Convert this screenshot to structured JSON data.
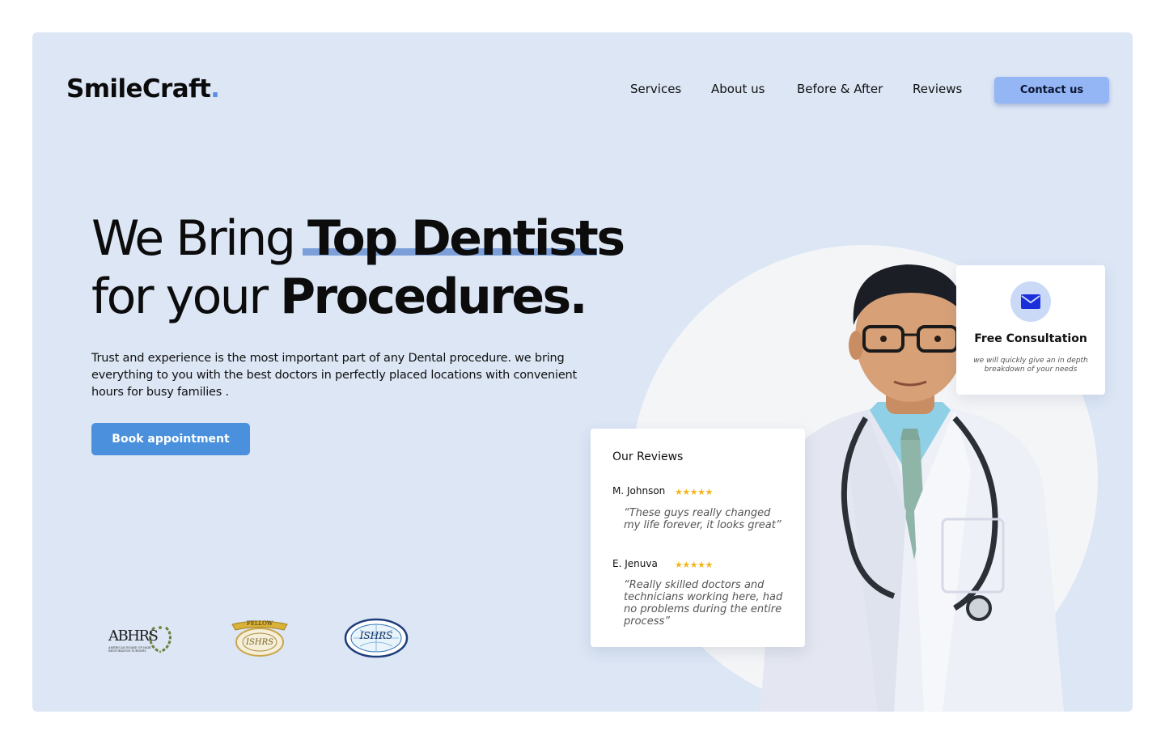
{
  "brand": {
    "name": "SmileCraft",
    "dot": "."
  },
  "nav": {
    "items": [
      {
        "label": "Services"
      },
      {
        "label": "About us"
      },
      {
        "label": "Before & After"
      },
      {
        "label": "Reviews"
      }
    ],
    "contact_label": "Contact  us"
  },
  "hero": {
    "line1_regular": "We Bring ",
    "line1_bold": "Top Dentists",
    "line2_regular": "for your ",
    "line2_bold": "Procedures.",
    "description": "Trust and experience is the most important part of any Dental procedure. we bring everything to you with the best doctors in perfectly placed locations with convenient hours for busy families .",
    "cta_label": "Book appointment"
  },
  "badges": {
    "abhrs": {
      "acronym": "ABHRS",
      "full": "AMERICAN BOARD OF HAIR RESTORATION SURGERY"
    },
    "fellow": {
      "ribbon": "FELLOW",
      "seal": "ISHRS"
    },
    "ishrs": {
      "acronym": "ISHRS"
    }
  },
  "consultation": {
    "icon": "mail-icon",
    "title": "Free Consultation",
    "subtitle": "we will quickly give an in depth breakdown of your needs"
  },
  "reviews": {
    "title": "Our Reviews",
    "items": [
      {
        "name": "M. Johnson",
        "stars": "★★★★★",
        "rating": 5,
        "quote": "“These guys really changed my life forever, it looks great”"
      },
      {
        "name": "E. Jenuva",
        "stars": "★★★★★",
        "rating": 5,
        "quote": "“Really skilled doctors and technicians working here, had no problems during the entire process”"
      }
    ]
  },
  "colors": {
    "background": "#dce6f5",
    "accent": "#4a90dc",
    "contact_button": "#94b6f5",
    "highlight_underline": "#7d9fd9",
    "star": "#f2b51c"
  }
}
